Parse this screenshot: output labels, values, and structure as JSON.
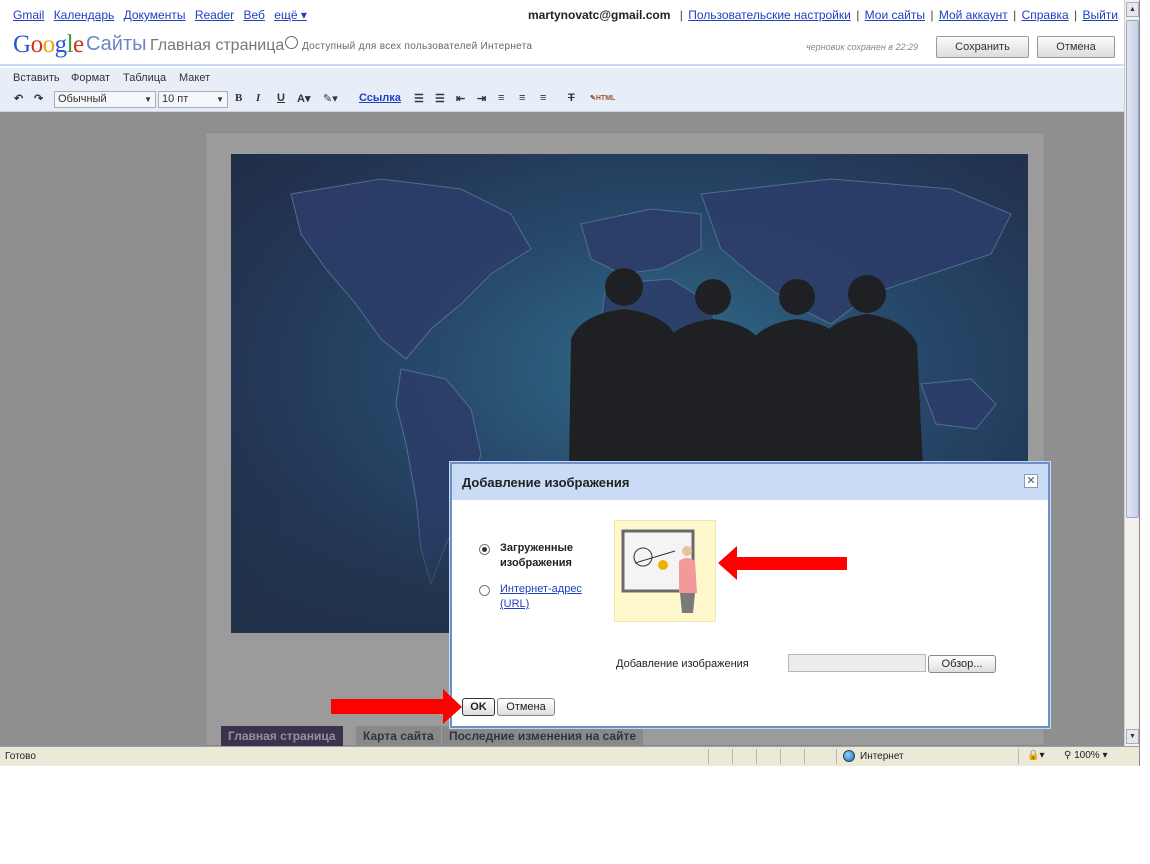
{
  "gbar": {
    "links": [
      "Gmail",
      "Календарь",
      "Документы",
      "Reader",
      "Веб",
      "ещё ▾"
    ],
    "email": "martynovatc@gmail.com",
    "account_links": [
      "Пользовательские настройки",
      "Мои сайты",
      "Мой аккаунт",
      "Справка",
      "Выйти"
    ]
  },
  "header": {
    "logo_letters": [
      "G",
      "o",
      "o",
      "g",
      "l",
      "e"
    ],
    "product": "Сайты",
    "page_title": "Главная страница",
    "access_note": "Доступный для всех пользователей Интернета",
    "draft_note": "черновик сохранен в 22:29",
    "save_label": "Сохранить",
    "cancel_label": "Отмена"
  },
  "editor": {
    "menus": [
      "Вставить",
      "Формат",
      "Таблица",
      "Макет"
    ],
    "style_select": "Обычный",
    "size_select": "10 пт",
    "link_label": "Ссылка",
    "html_label": "HTML"
  },
  "site_nav": {
    "tabs": [
      "Главная страница",
      "Карта сайта",
      "Последние изменения на сайте"
    ]
  },
  "dialog": {
    "title": "Добавление изображения",
    "option_uploaded": "Загруженные изображения",
    "option_url": "Интернет-адрес (URL)",
    "upload_label": "Добавление изображения",
    "browse_label": "Обзор...",
    "ok_label": "OK",
    "cancel_label": "Отмена"
  },
  "statusbar": {
    "ready": "Готово",
    "zone": "Интернет",
    "zoom": "100%"
  },
  "colors": {
    "arrow": "#ff0000",
    "link": "#2040c0",
    "dialog_title_bg": "#c9dbf5",
    "nav_active_bg": "#3b2a5c"
  }
}
